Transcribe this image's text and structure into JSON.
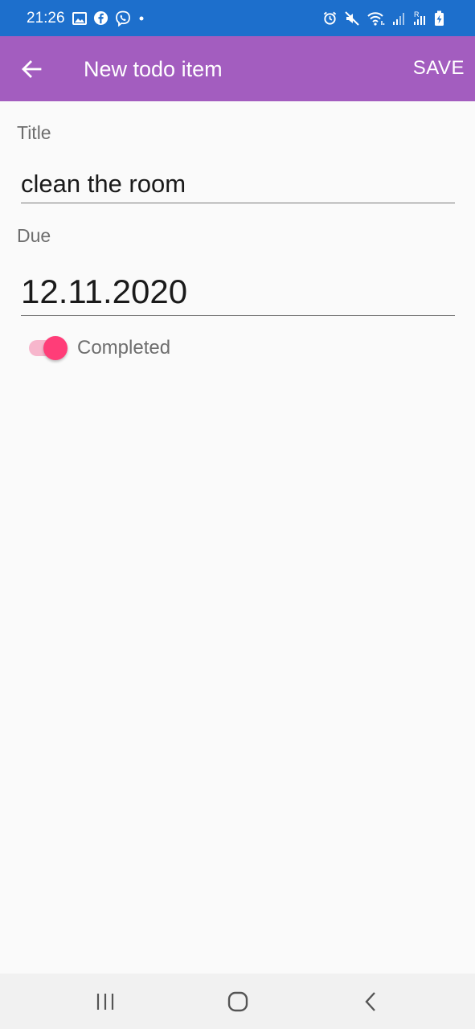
{
  "status_bar": {
    "time": "21:26",
    "left_icons": [
      "image-icon",
      "facebook-icon",
      "viber-icon",
      "dot-icon"
    ],
    "right_icons": [
      "alarm-icon",
      "mute-icon",
      "wifi-icon",
      "signal-icon",
      "signal-roaming-icon",
      "battery-charging-icon"
    ],
    "roaming_label": "R"
  },
  "app_bar": {
    "title": "New todo item",
    "save_label": "SAVE",
    "color": "#a35dbf"
  },
  "form": {
    "title_label": "Title",
    "title_value": "clean the room",
    "due_label": "Due",
    "due_value": "12.11.2020",
    "completed_label": "Completed",
    "completed": true,
    "toggle_color": "#ff3d78"
  },
  "nav_bar": {
    "buttons": [
      "recent-apps-icon",
      "home-icon",
      "back-icon"
    ]
  }
}
